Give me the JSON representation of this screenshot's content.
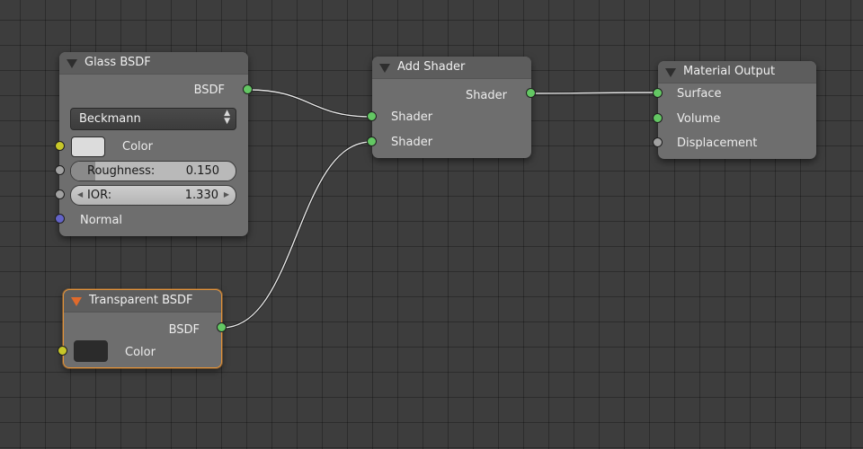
{
  "nodes": {
    "glass_bsdf": {
      "title": "Glass BSDF",
      "output_label": "BSDF",
      "distribution": "Beckmann",
      "color_label": "Color",
      "color_value": "#dcdcdc",
      "roughness_label": "Roughness:",
      "roughness_value": "0.150",
      "roughness_fraction": 0.15,
      "ior_label": "IOR:",
      "ior_value": "1.330",
      "normal_label": "Normal"
    },
    "add_shader": {
      "title": "Add Shader",
      "output_label": "Shader",
      "input1_label": "Shader",
      "input2_label": "Shader"
    },
    "material_output": {
      "title": "Material Output",
      "surface_label": "Surface",
      "volume_label": "Volume",
      "displacement_label": "Displacement"
    },
    "transparent_bsdf": {
      "title": "Transparent BSDF",
      "output_label": "BSDF",
      "color_label": "Color",
      "color_value": "#2b2b2b"
    }
  },
  "colors": {
    "socket_shader": "#63c763",
    "socket_color": "#c7c729",
    "socket_value": "#a1a1a1",
    "socket_vector": "#6363c7",
    "active_outline": "#e0923a",
    "link": "#e8e8e8"
  }
}
